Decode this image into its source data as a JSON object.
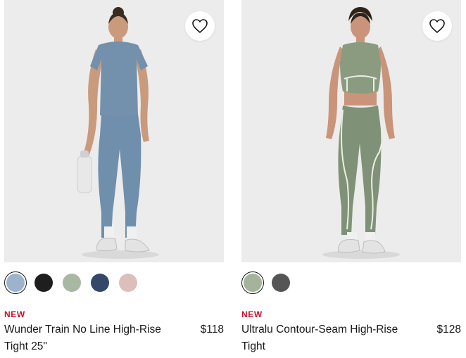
{
  "colors": {
    "badge": "#c8102e",
    "image_bg": "#ececec"
  },
  "products": [
    {
      "badge": "NEW",
      "name": "Wunder Train No Line High-Rise Tight 25\"",
      "price": "$118",
      "wishlist_icon": "heart-outline-icon",
      "swatches": [
        {
          "color": "#9db3cd",
          "selected": true
        },
        {
          "color": "#1e1e1e",
          "selected": false
        },
        {
          "color": "#a9b8a2",
          "selected": false
        },
        {
          "color": "#34486a",
          "selected": false
        },
        {
          "color": "#dcbfbb",
          "selected": false
        }
      ]
    },
    {
      "badge": "NEW",
      "name": "Ultralu Contour-Seam High-Rise Tight",
      "price": "$128",
      "wishlist_icon": "heart-outline-icon",
      "swatches": [
        {
          "color": "#a4b39a",
          "selected": true
        },
        {
          "color": "#555555",
          "selected": false
        }
      ]
    }
  ]
}
